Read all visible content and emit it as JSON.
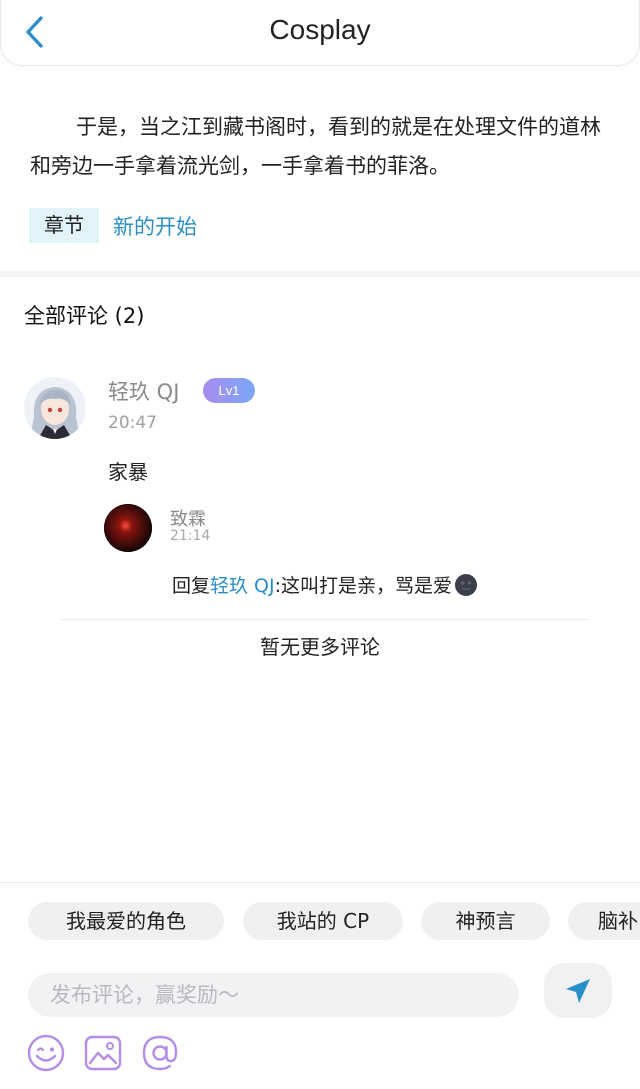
{
  "header": {
    "title": "Cosplay",
    "back_icon": "chevron-left-icon"
  },
  "excerpt": "于是，当之江到藏书阁时，看到的就是在处理文件的道林和旁边一手拿着流光剑，一手拿着书的菲洛。",
  "chapter": {
    "tag": "章节",
    "name": "新的开始"
  },
  "comments": {
    "title": "全部评论 (2)",
    "items": [
      {
        "user": "轻玖 QJ",
        "level": "Lv1",
        "time": "20:47",
        "text": "家暴",
        "replies": [
          {
            "user": "致霖",
            "time": "21:14",
            "prefix": "回复",
            "target": "轻玖 QJ",
            "text": ":这叫打是亲，骂是爱"
          }
        ]
      }
    ],
    "end_text": "暂无更多评论"
  },
  "bottom": {
    "chips": [
      "我最爱的角色",
      "我站的 CP",
      "神预言",
      "脑补"
    ],
    "input_placeholder": "发布评论，赢奖励～",
    "send_icon": "send-icon",
    "tools": [
      "emoji-icon",
      "image-icon",
      "at-icon"
    ]
  },
  "colors": {
    "accent": "#2a8fc8",
    "tag_bg": "#e3f3fb",
    "badge_from": "#a98cf0",
    "badge_to": "#7aa8f5",
    "tool_purple": "#b48ee6"
  }
}
